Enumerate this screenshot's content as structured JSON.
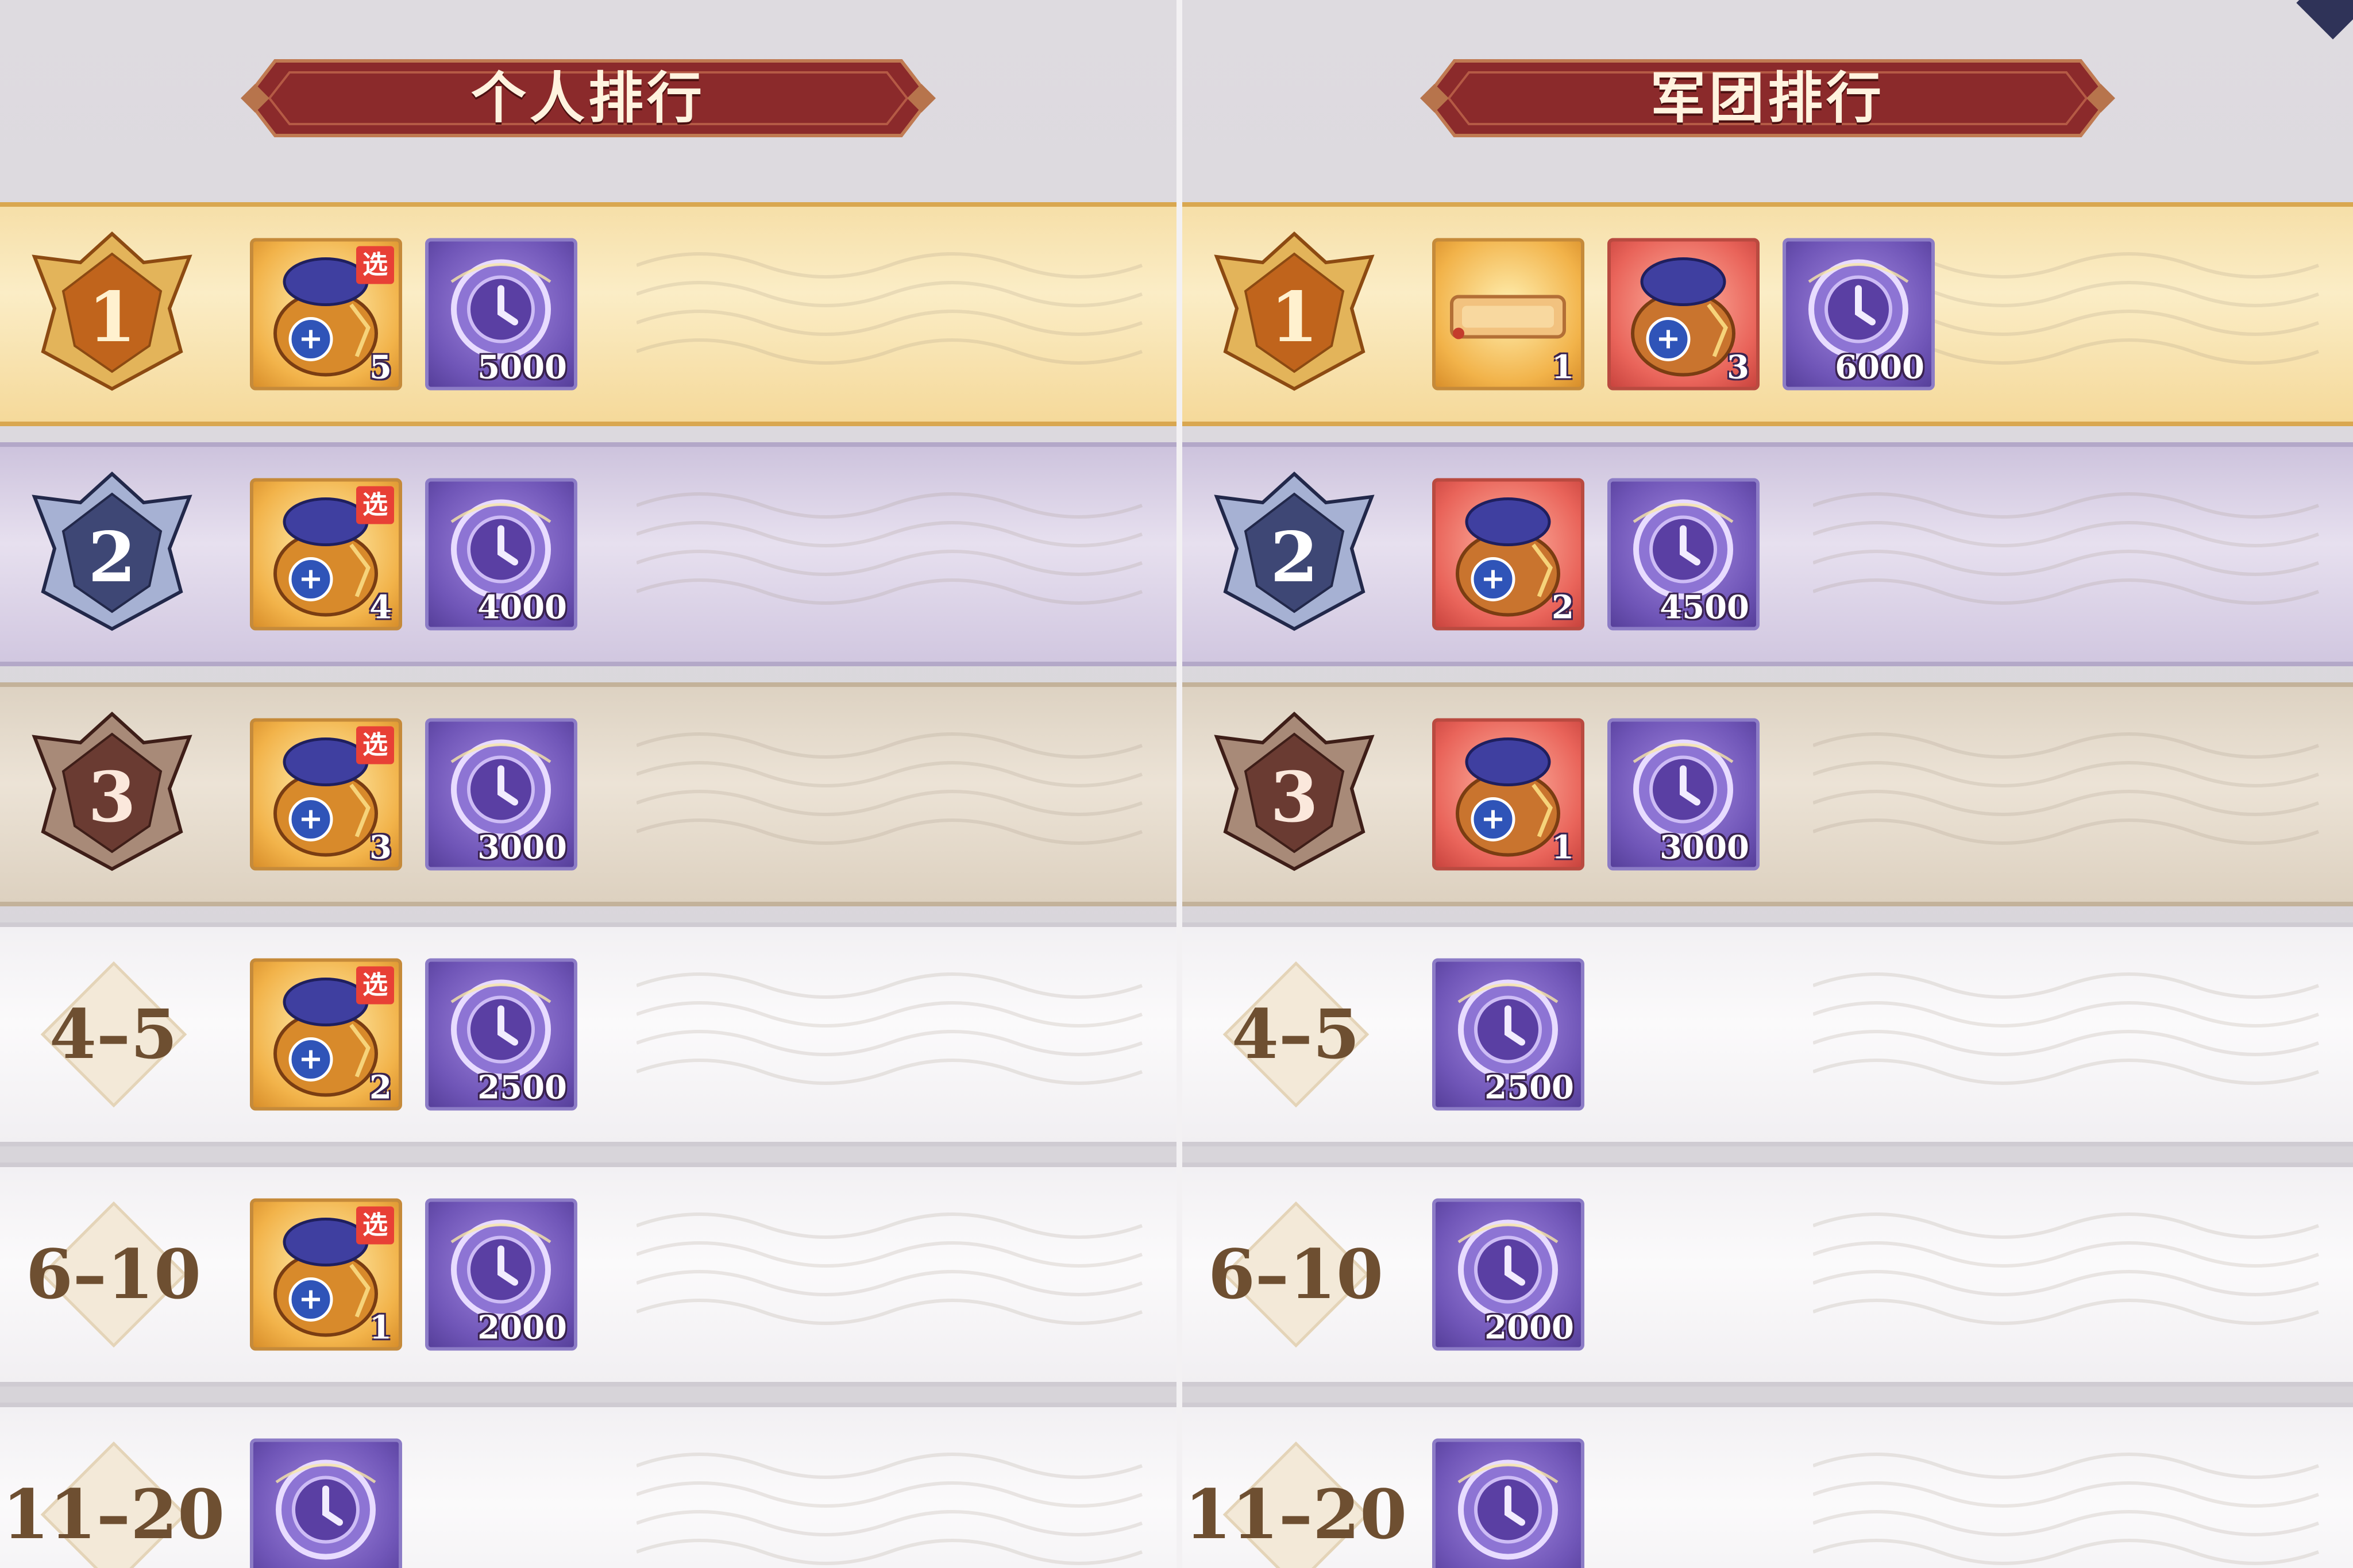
{
  "colors": {
    "gold_row": "#f6dfa8",
    "silver_row": "#e7e0ef",
    "bronze_row": "#ece3d6",
    "plain_row": "#fbfafb",
    "banner": "#8e2a2c",
    "rank_text": "#6e4f31",
    "coin": "#6f55b7"
  },
  "personal": {
    "title": "个人排行",
    "rows": [
      {
        "rank": "1",
        "tier": "gold",
        "rewards": [
          {
            "type": "choice-bag",
            "icon": "selectable-gift-bag-icon",
            "badge": "选",
            "qty": "5"
          },
          {
            "type": "coin",
            "icon": "purple-coin-icon",
            "qty": "5000"
          }
        ]
      },
      {
        "rank": "2",
        "tier": "silver",
        "rewards": [
          {
            "type": "choice-bag",
            "icon": "selectable-gift-bag-icon",
            "badge": "选",
            "qty": "4"
          },
          {
            "type": "coin",
            "icon": "purple-coin-icon",
            "qty": "4000"
          }
        ]
      },
      {
        "rank": "3",
        "tier": "bronze",
        "rewards": [
          {
            "type": "choice-bag",
            "icon": "selectable-gift-bag-icon",
            "badge": "选",
            "qty": "3"
          },
          {
            "type": "coin",
            "icon": "purple-coin-icon",
            "qty": "3000"
          }
        ]
      },
      {
        "rank": "4–5",
        "tier": "plain",
        "rewards": [
          {
            "type": "choice-bag",
            "icon": "selectable-gift-bag-icon",
            "badge": "选",
            "qty": "2"
          },
          {
            "type": "coin",
            "icon": "purple-coin-icon",
            "qty": "2500"
          }
        ]
      },
      {
        "rank": "6–10",
        "tier": "plain",
        "rewards": [
          {
            "type": "choice-bag",
            "icon": "selectable-gift-bag-icon",
            "badge": "选",
            "qty": "1"
          },
          {
            "type": "coin",
            "icon": "purple-coin-icon",
            "qty": "2000"
          }
        ]
      },
      {
        "rank": "11–20",
        "tier": "plain",
        "rewards": [
          {
            "type": "coin",
            "icon": "purple-coin-icon",
            "qty": ""
          }
        ]
      }
    ]
  },
  "legion": {
    "title": "军团排行",
    "rows": [
      {
        "rank": "1",
        "tier": "gold",
        "rewards": [
          {
            "type": "title-plate",
            "icon": "title-plate-icon",
            "qty": "1"
          },
          {
            "type": "red-bag",
            "icon": "red-gift-bag-icon",
            "qty": "3"
          },
          {
            "type": "coin",
            "icon": "purple-coin-icon",
            "qty": "6000"
          }
        ]
      },
      {
        "rank": "2",
        "tier": "silver",
        "rewards": [
          {
            "type": "red-bag",
            "icon": "red-gift-bag-icon",
            "qty": "2"
          },
          {
            "type": "coin",
            "icon": "purple-coin-icon",
            "qty": "4500"
          }
        ]
      },
      {
        "rank": "3",
        "tier": "bronze",
        "rewards": [
          {
            "type": "red-bag",
            "icon": "red-gift-bag-icon",
            "qty": "1"
          },
          {
            "type": "coin",
            "icon": "purple-coin-icon",
            "qty": "3000"
          }
        ]
      },
      {
        "rank": "4–5",
        "tier": "plain",
        "rewards": [
          {
            "type": "coin",
            "icon": "purple-coin-icon",
            "qty": "2500"
          }
        ]
      },
      {
        "rank": "6–10",
        "tier": "plain",
        "rewards": [
          {
            "type": "coin",
            "icon": "purple-coin-icon",
            "qty": "2000"
          }
        ]
      },
      {
        "rank": "11–20",
        "tier": "plain",
        "rewards": [
          {
            "type": "coin",
            "icon": "purple-coin-icon",
            "qty": ""
          }
        ]
      }
    ]
  }
}
